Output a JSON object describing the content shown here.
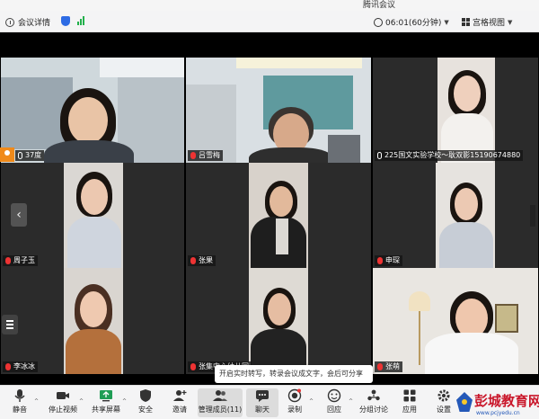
{
  "window": {
    "title": "腾讯会议"
  },
  "topbar": {
    "meeting_details": "会议详情",
    "timer": "06:01(60分钟)",
    "layout_label": "宫格视图"
  },
  "participants": [
    {
      "name": "37度",
      "mic": "on"
    },
    {
      "name": "吕雪梅",
      "mic": "off"
    },
    {
      "name": "225国文实验学校～耿双影15190674880",
      "mic": "on"
    },
    {
      "name": "周子玉",
      "mic": "off"
    },
    {
      "name": "张果",
      "mic": "off"
    },
    {
      "name": "申琛",
      "mic": "off"
    },
    {
      "name": "李冰冰",
      "mic": "off"
    },
    {
      "name": "张集中心幼儿园",
      "mic": "off"
    },
    {
      "name": "张萌",
      "mic": "off"
    }
  ],
  "toast": {
    "text": "开启实时转写，转录会议成文字，会后可分享"
  },
  "toolbar": {
    "mute": "静音",
    "stop_video": "停止视频",
    "share_screen": "共享屏幕",
    "security": "安全",
    "invite": "邀请",
    "manage_members": "管理成员(11)",
    "chat": "聊天",
    "record": "录制",
    "interact": "回应",
    "breakout": "分组讨论",
    "apps": "应用",
    "settings": "设置"
  },
  "watermark": {
    "name": "彭城教育网",
    "url": "www.pcjyedu.cn"
  },
  "colors": {
    "accent": "#2d6be4",
    "signal": "#22b04b",
    "muted": "#e33333",
    "brand": "#c9162a"
  }
}
